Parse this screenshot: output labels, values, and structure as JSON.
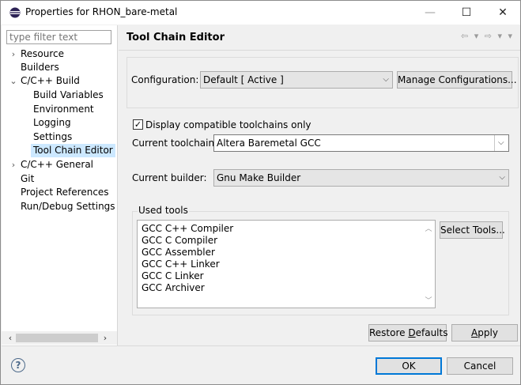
{
  "window": {
    "title": "Properties for RHON_bare-metal",
    "minimize_glyph": "—",
    "maximize_glyph": "☐",
    "close_glyph": "✕"
  },
  "sidebar": {
    "filter_placeholder": "type filter text",
    "items": [
      {
        "label": "Resource",
        "toggle": "›"
      },
      {
        "label": "Builders",
        "toggle": ""
      },
      {
        "label": "C/C++ Build",
        "toggle": "⌄"
      },
      {
        "label": "Build Variables",
        "toggle": ""
      },
      {
        "label": "Environment",
        "toggle": ""
      },
      {
        "label": "Logging",
        "toggle": ""
      },
      {
        "label": "Settings",
        "toggle": ""
      },
      {
        "label": "Tool Chain Editor",
        "toggle": ""
      },
      {
        "label": "C/C++ General",
        "toggle": "›"
      },
      {
        "label": "Git",
        "toggle": ""
      },
      {
        "label": "Project References",
        "toggle": ""
      },
      {
        "label": "Run/Debug Settings",
        "toggle": ""
      }
    ],
    "scroll_left": "‹",
    "scroll_right": "›"
  },
  "page": {
    "title": "Tool Chain Editor",
    "nav_arrows": "⇦ ▾ ⇨ ▾ ▾"
  },
  "configuration": {
    "label": "Configuration:",
    "value": "Default  [ Active ]",
    "manage_button": "Manage Configurations..."
  },
  "toolchain": {
    "display_compatible_label": "Display compatible toolchains only",
    "checked": true,
    "current_toolchain_label": "Current toolchain:",
    "current_toolchain_value": "Altera Baremetal GCC",
    "current_builder_label": "Current builder:",
    "current_builder_value": "Gnu Make Builder"
  },
  "used_tools": {
    "legend": "Used tools",
    "items": [
      "GCC C++ Compiler",
      "GCC C Compiler",
      "GCC Assembler",
      "GCC C++ Linker",
      "GCC C Linker",
      "GCC Archiver"
    ],
    "select_tools_button": "Select Tools..."
  },
  "buttons": {
    "restore_pre": "Restore ",
    "restore_mn": "D",
    "restore_post": "efaults",
    "apply_mn": "A",
    "apply_post": "pply",
    "ok": "OK",
    "cancel": "Cancel",
    "help": "?"
  },
  "colors": {
    "selection": "#cce8ff",
    "accent": "#0078d7",
    "eclipse_icon": "#2c2255"
  }
}
